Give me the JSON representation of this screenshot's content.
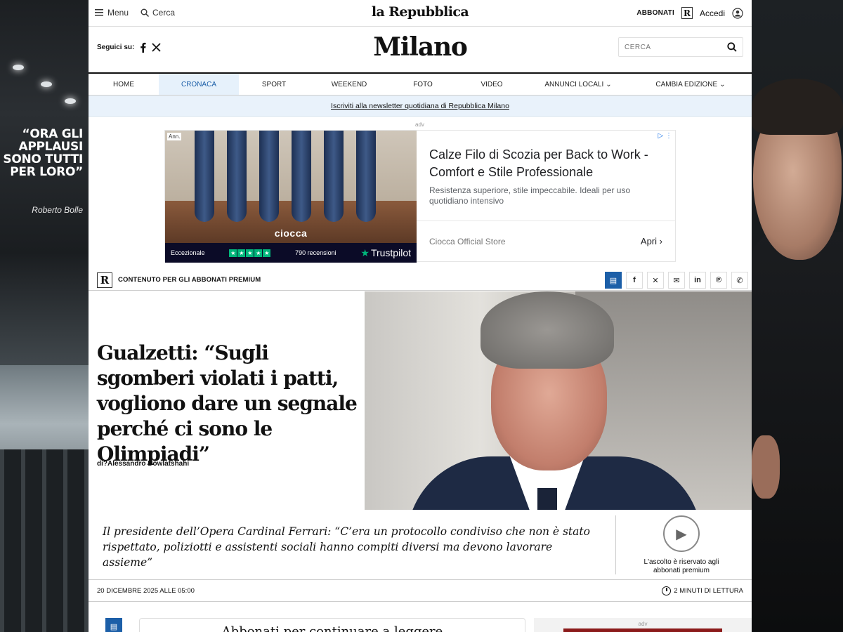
{
  "skin_left": {
    "quote": "“ORA GLI APPLAUSI SONO TUTTI PER LORO”",
    "signature": "Roberto Bolle"
  },
  "topbar": {
    "menu_label": "Menu",
    "search_label": "Cerca",
    "brand": "la Repubblica",
    "subscribe_label": "ABBONATI",
    "r_logo": "R",
    "login_label": "Accedi"
  },
  "masthead": {
    "follow_label": "Seguici su:",
    "edition": "Milano",
    "search_placeholder": "CERCA"
  },
  "nav": {
    "items": [
      {
        "label": "HOME"
      },
      {
        "label": "CRONACA",
        "active": true
      },
      {
        "label": "SPORT"
      },
      {
        "label": "WEEKEND"
      },
      {
        "label": "FOTO"
      },
      {
        "label": "VIDEO"
      },
      {
        "label": "ANNUNCI LOCALI",
        "dropdown": true
      },
      {
        "label": "CAMBIA EDIZIONE",
        "dropdown": true
      }
    ]
  },
  "newsletter": {
    "label": "Iscriviti alla newsletter quotidiana di Repubblica Milano"
  },
  "ad": {
    "label": "adv",
    "ann_badge": "Ann.",
    "brand_logo": "ciocca",
    "rating_text": "Eccezionale",
    "reviews": "790 recensioni",
    "trustpilot": "Trustpilot",
    "title": "Calze Filo di Scozia per Back to Work - Comfort e Stile Professionale",
    "description": "Resistenza superiore, stile impeccabile. Ideali per uso quotidiano intensivo",
    "store": "Ciocca Official Store",
    "cta": "Apri"
  },
  "share": {
    "premium_label": "CONTENUTO PER GLI ABBONATI PREMIUM",
    "icons": [
      "comment-icon",
      "facebook-icon",
      "x-icon",
      "email-icon",
      "linkedin-icon",
      "pinterest-icon",
      "whatsapp-icon"
    ]
  },
  "article": {
    "title": "Gualzetti: “Sugli sgomberi violati i patti, vogliono dare un segnale perché ci sono le Olimpiadi”",
    "author": "di?Alessandro Dowlatshahi",
    "lead": "Il presidente dell’Opera Cardinal Ferrari: “C’era un protocollo condiviso che non è stato rispettato, poliziotti e assistenti sociali hanno compiti diversi ma devono lavorare assieme”",
    "listen_note": "L'ascolto è riservato agli abbonati premium",
    "date": "20 DICEMBRE 2025 ALLE 05:00",
    "reading_time": "2 MINUTI DI LETTURA"
  },
  "bottom": {
    "paywall_title": "Abbonati per continuare a leggere",
    "ad_label": "adv"
  },
  "colors": {
    "accent_blue": "#1c5fa8",
    "nav_active_bg": "#e6f1fb",
    "newsletter_bg": "#e9f2fb",
    "trustpilot_green": "#00b67a"
  }
}
